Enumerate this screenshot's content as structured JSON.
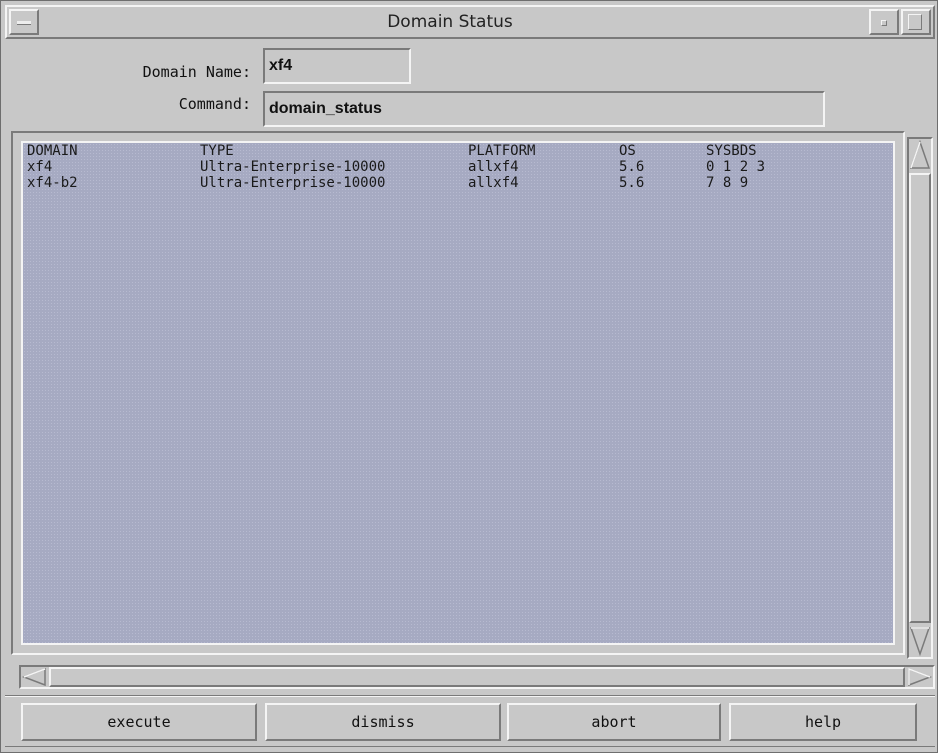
{
  "window": {
    "title": "Domain Status"
  },
  "form": {
    "domain_name_label": "Domain Name:",
    "domain_name_value": "xf4",
    "command_label": "Command:",
    "command_value": "domain_status"
  },
  "output": {
    "headers": {
      "domain": "DOMAIN",
      "type": "TYPE",
      "platform": "PLATFORM",
      "os": "OS",
      "sysbds": "SYSBDS"
    },
    "rows": [
      {
        "domain": "xf4",
        "type": "Ultra-Enterprise-10000",
        "platform": "allxf4",
        "os": "5.6",
        "sysbds": "0 1 2 3"
      },
      {
        "domain": "xf4-b2",
        "type": "Ultra-Enterprise-10000",
        "platform": "allxf4",
        "os": "5.6",
        "sysbds": "7 8 9"
      }
    ]
  },
  "buttons": {
    "execute": "execute",
    "dismiss": "dismiss",
    "abort": "abort",
    "help": "help"
  },
  "colors": {
    "window_bg": "#c8c8c8",
    "output_bg": "#a6aac2",
    "highlight": "#f4f4f4",
    "shadow": "#7a7a7a"
  },
  "icons": {
    "window_menu": "window-menu-icon",
    "minimize": "minimize-icon",
    "maximize": "maximize-icon",
    "scroll_up": "triangle-up-icon",
    "scroll_down": "triangle-down-icon",
    "scroll_left": "triangle-left-icon",
    "scroll_right": "triangle-right-icon"
  }
}
